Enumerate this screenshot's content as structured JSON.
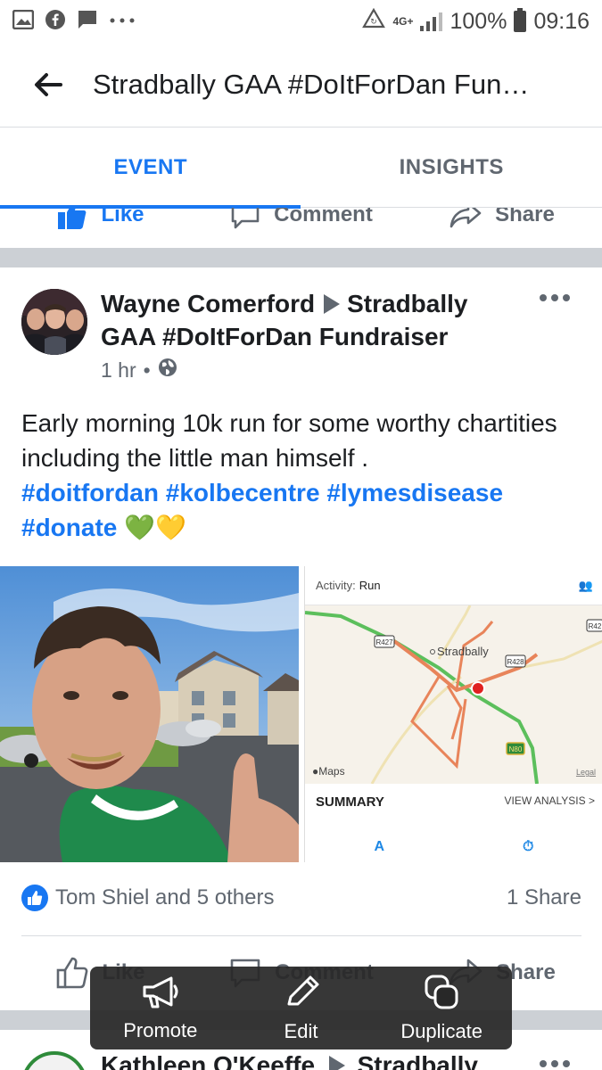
{
  "status_bar": {
    "network": "4G+",
    "battery": "100%",
    "time": "09:16",
    "left_icons": [
      "gallery-icon",
      "facebook-icon",
      "message-icon",
      "more-dots-icon"
    ]
  },
  "header": {
    "title": "Stradbally GAA #DoItForDan Fun…"
  },
  "tabs": [
    {
      "label": "EVENT",
      "active": true
    },
    {
      "label": "INSIGHTS",
      "active": false
    }
  ],
  "prev_post_actions": {
    "like": "Like",
    "comment": "Comment",
    "share": "Share"
  },
  "post": {
    "author": "Wayne Comerford",
    "target": "Stradbally GAA #DoItForDan Fundraiser",
    "time": "1 hr",
    "privacy_icon": "globe-icon",
    "text": "Early morning 10k run for some worthy chartities including the little man himself .",
    "hashtags": [
      "#doitfordan",
      "#kolbecentre",
      "#lymesdisease",
      "#donate"
    ],
    "emoji": "💚💛",
    "map_card": {
      "activity_label": "Activity:",
      "activity_value": "Run",
      "place": "Stradbally",
      "roads": [
        "R427",
        "R428",
        "R42",
        "N80"
      ],
      "maps_label": "Maps",
      "legal": "Legal",
      "summary": "SUMMARY",
      "view_analysis": "VIEW ANALYSIS"
    },
    "reactions_text": "Tom Shiel and 5 others",
    "shares_text": "1 Share",
    "actions": {
      "like": "Like",
      "comment": "Comment",
      "share": "Share"
    }
  },
  "floating_bar": {
    "promote": "Promote",
    "edit": "Edit",
    "duplicate": "Duplicate"
  },
  "next_post": {
    "author_partial": "Kathleen O'Keeffe",
    "target_partial": "Stradbally"
  },
  "colors": {
    "facebook_blue": "#1877f2",
    "secondary_text": "#606770",
    "divider_band": "#ccd0d5",
    "floating_bar": "#282828"
  }
}
